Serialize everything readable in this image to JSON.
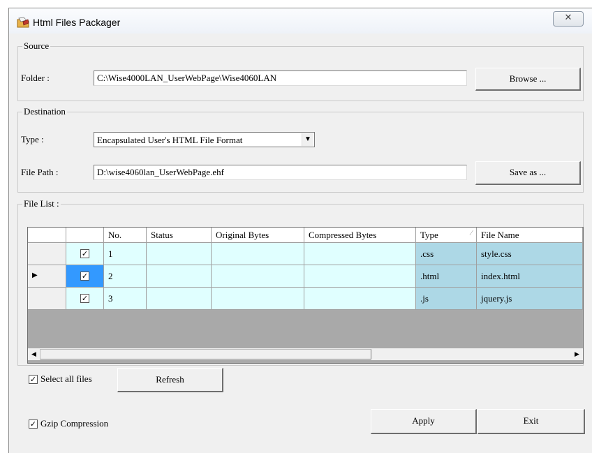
{
  "window": {
    "title": "Html Files Packager",
    "close_glyph": "✕",
    "icon": "folder-package-icon"
  },
  "source": {
    "legend": "Source",
    "folder_label": "Folder :",
    "folder_value": "C:\\Wise4000LAN_UserWebPage\\Wise4060LAN",
    "browse_label": "Browse ..."
  },
  "destination": {
    "legend": "Destination",
    "type_label": "Type :",
    "type_value": "Encapsulated User's HTML File Format",
    "filepath_label": "File Path :",
    "filepath_value": "D:\\wise4060lan_UserWebPage.ehf",
    "saveas_label": "Save as ..."
  },
  "file_list": {
    "legend": "File List :",
    "columns": [
      "No.",
      "Status",
      "Original Bytes",
      "Compressed Bytes",
      "Type",
      "File Name"
    ],
    "rows": [
      {
        "checked": true,
        "no": "1",
        "status": "",
        "original": "",
        "compressed": "",
        "type": ".css",
        "name": "style.css"
      },
      {
        "checked": true,
        "no": "2",
        "status": "",
        "original": "",
        "compressed": "",
        "type": ".html",
        "name": "index.html"
      },
      {
        "checked": true,
        "no": "3",
        "status": "",
        "original": "",
        "compressed": "",
        "type": ".js",
        "name": "jquery.js"
      }
    ],
    "selected_row_index": 1
  },
  "bottom": {
    "select_all_label": "Select all files",
    "select_all_checked": true,
    "refresh_label": "Refresh",
    "gzip_label": "Gzip Compression",
    "gzip_checked": true,
    "apply_label": "Apply",
    "exit_label": "Exit"
  },
  "colors": {
    "cell_cyan": "#e0ffff",
    "cell_blue": "#add8e6",
    "selected_cell": "#3399ff",
    "grid_background": "#a9a9a9"
  }
}
